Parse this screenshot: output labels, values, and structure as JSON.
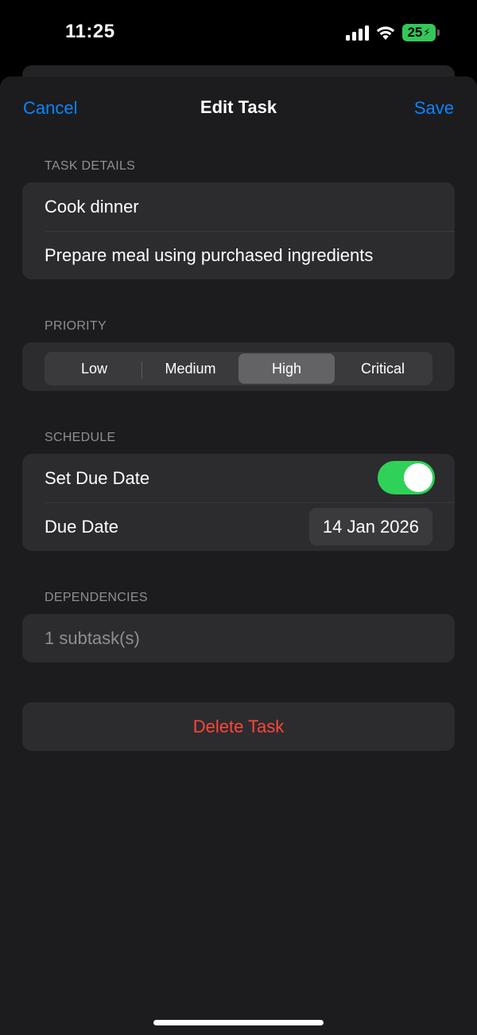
{
  "status_bar": {
    "time": "11:25",
    "battery_level": "25",
    "battery_color": "#34c759"
  },
  "nav": {
    "cancel_label": "Cancel",
    "title": "Edit Task",
    "save_label": "Save",
    "accent_color": "#0a84ff"
  },
  "task_details": {
    "header": "TASK DETAILS",
    "title_value": "Cook dinner",
    "description_value": "Prepare meal using purchased ingredients"
  },
  "priority": {
    "header": "PRIORITY",
    "options": [
      "Low",
      "Medium",
      "High",
      "Critical"
    ],
    "selected": "High"
  },
  "schedule": {
    "header": "SCHEDULE",
    "set_due_date_label": "Set Due Date",
    "set_due_date_on": true,
    "due_date_label": "Due Date",
    "due_date_value": "14 Jan 2026",
    "toggle_color": "#30d158"
  },
  "dependencies": {
    "header": "DEPENDENCIES",
    "summary": "1 subtask(s)"
  },
  "actions": {
    "delete_label": "Delete Task",
    "delete_color": "#ff453a"
  }
}
